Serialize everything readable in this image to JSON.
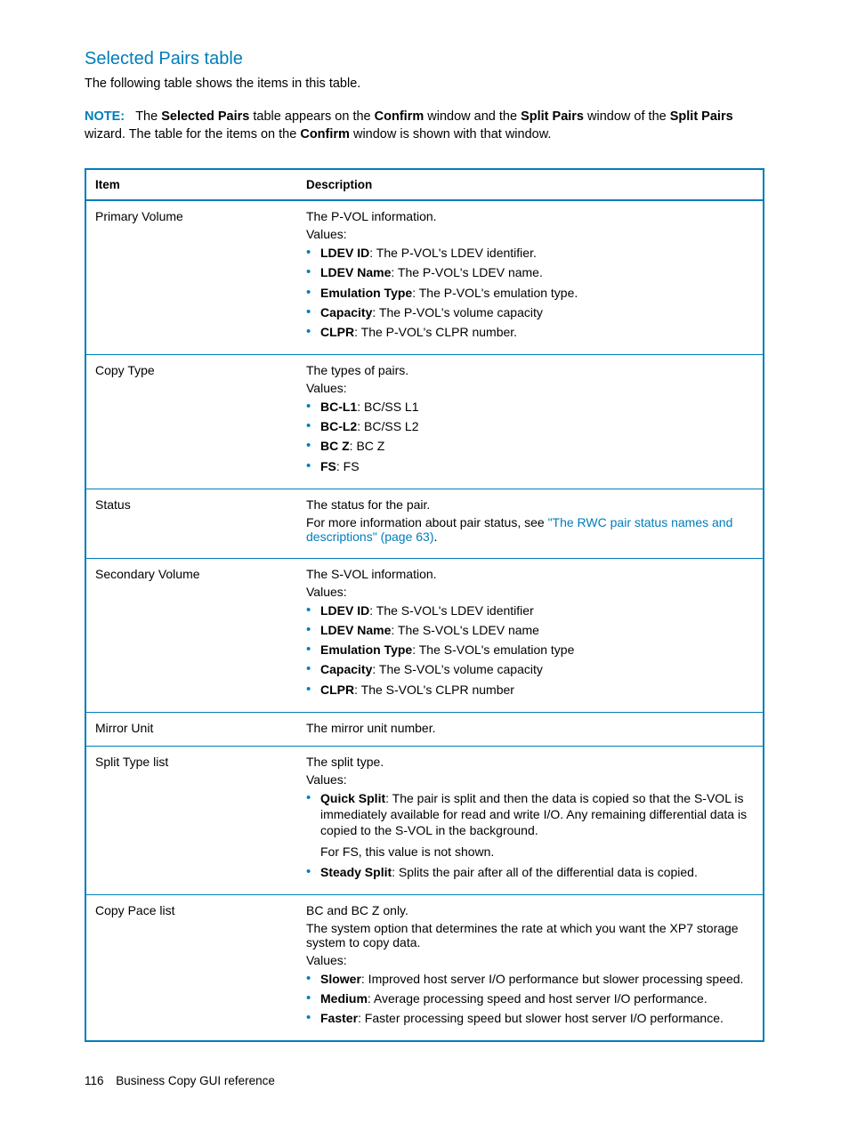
{
  "heading": "Selected Pairs table",
  "intro": "The following table shows the items in this table.",
  "note": {
    "label": "NOTE:",
    "parts": {
      "p1": "The ",
      "b1": "Selected Pairs",
      "p2": " table appears on the ",
      "b2": "Confirm",
      "p3": " window and the ",
      "b3": "Split Pairs",
      "p4": " window of the ",
      "b4": "Split Pairs",
      "p5": " wizard. The table for the items on the ",
      "b5": "Confirm",
      "p6": " window is shown with that window."
    }
  },
  "table": {
    "headers": {
      "item": "Item",
      "desc": "Description"
    },
    "rows": {
      "primaryVolume": {
        "item": "Primary Volume",
        "line1": "The P-VOL information.",
        "line2": "Values:",
        "bullets": {
          "b0": {
            "bold": "LDEV ID",
            "rest": ": The P-VOL's LDEV identifier."
          },
          "b1": {
            "bold": "LDEV Name",
            "rest": ": The P-VOL's LDEV name."
          },
          "b2": {
            "bold": "Emulation Type",
            "rest": ": The P-VOL's emulation type."
          },
          "b3": {
            "bold": "Capacity",
            "rest": ": The P-VOL's volume capacity"
          },
          "b4": {
            "bold": "CLPR",
            "rest": ": The P-VOL's CLPR number."
          }
        }
      },
      "copyType": {
        "item": "Copy Type",
        "line1": "The types of pairs.",
        "line2": "Values:",
        "bullets": {
          "b0": {
            "bold": "BC-L1",
            "rest": ": BC/SS L1"
          },
          "b1": {
            "bold": "BC-L2",
            "rest": ": BC/SS L2"
          },
          "b2": {
            "bold": "BC Z",
            "rest": ": BC Z"
          },
          "b3": {
            "bold": "FS",
            "rest": ": FS"
          }
        }
      },
      "status": {
        "item": "Status",
        "line1": "The status for the pair.",
        "line2a": "For more information about pair status, see ",
        "link": "\"The RWC pair status names and descriptions\" (page 63)",
        "line2b": "."
      },
      "secondaryVolume": {
        "item": "Secondary Volume",
        "line1": "The S-VOL information.",
        "line2": "Values:",
        "bullets": {
          "b0": {
            "bold": "LDEV ID",
            "rest": ": The S-VOL's LDEV identifier"
          },
          "b1": {
            "bold": "LDEV Name",
            "rest": ": The S-VOL's LDEV name"
          },
          "b2": {
            "bold": "Emulation Type",
            "rest": ": The S-VOL's emulation type"
          },
          "b3": {
            "bold": "Capacity",
            "rest": ": The S-VOL's volume capacity"
          },
          "b4": {
            "bold": "CLPR",
            "rest": ": The S-VOL's CLPR number"
          }
        }
      },
      "mirrorUnit": {
        "item": "Mirror Unit",
        "line1": "The mirror unit number."
      },
      "splitType": {
        "item": "Split Type list",
        "line1": "The split type.",
        "line2": "Values:",
        "bullets": {
          "b0": {
            "bold": "Quick Split",
            "rest": ": The pair is split and then the data is copied so that the S-VOL is immediately available for read and write I/O. Any remaining differential data is copied to the S-VOL in the background.",
            "extra": "For FS, this value is not shown."
          },
          "b1": {
            "bold": "Steady Split",
            "rest": ": Splits the pair after all of the differential data is copied."
          }
        }
      },
      "copyPace": {
        "item": "Copy Pace list",
        "line1": "BC and BC Z only.",
        "line2": "The system option that determines the rate at which you want the XP7 storage system to copy data.",
        "line3": "Values:",
        "bullets": {
          "b0": {
            "bold": "Slower",
            "rest": ": Improved host server I/O performance but slower processing speed."
          },
          "b1": {
            "bold": "Medium",
            "rest": ": Average processing speed and host server I/O performance."
          },
          "b2": {
            "bold": "Faster",
            "rest": ": Faster processing speed but slower host server I/O performance."
          }
        }
      }
    }
  },
  "footer": {
    "pageNumber": "116",
    "title": "Business Copy GUI reference"
  }
}
